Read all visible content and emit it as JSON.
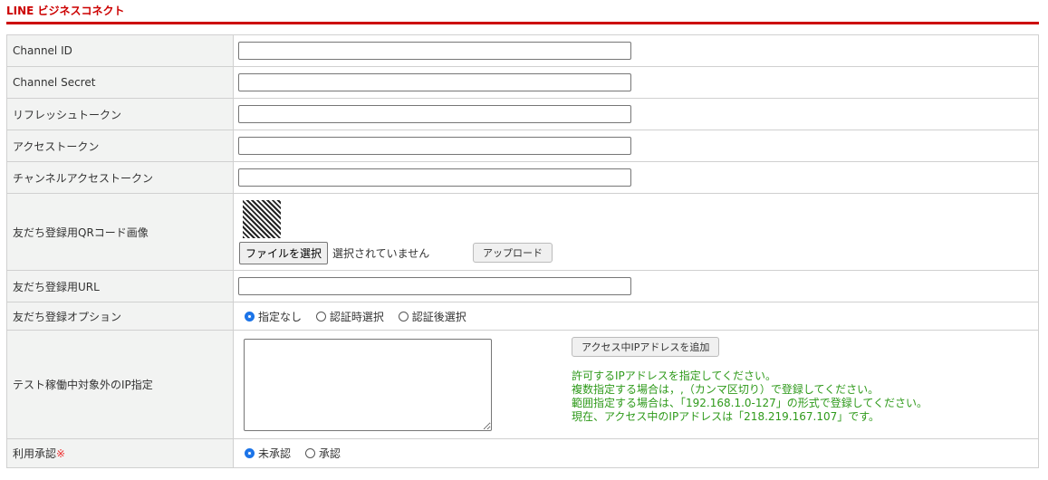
{
  "title": "LINE ビジネスコネクト",
  "rows": {
    "channel_id": "Channel ID",
    "channel_secret": "Channel Secret",
    "refresh_token": "リフレッシュトークン",
    "access_token": "アクセストークン",
    "channel_access_token": "チャンネルアクセストークン",
    "qr_image": "友だち登録用QRコード画像",
    "url": "友だち登録用URL",
    "option": "友だち登録オプション",
    "ip": "テスト稼働中対象外のIP指定",
    "approval": "利用承認",
    "required_mark": "※"
  },
  "qr": {
    "file_button": "ファイルを選択",
    "file_status": "選択されていません",
    "upload_button": "アップロード"
  },
  "option_radios": [
    {
      "label": "指定なし",
      "checked": true
    },
    {
      "label": "認証時選択",
      "checked": false
    },
    {
      "label": "認証後選択",
      "checked": false
    }
  ],
  "ip": {
    "add_button": "アクセス中IPアドレスを追加",
    "notes": [
      "許可するIPアドレスを指定してください。",
      "複数指定する場合は，,（カンマ区切り）で登録してください。",
      "範囲指定する場合は、「192.168.1.0-127」の形式で登録してください。",
      "現在、アクセス中のIPアドレスは「218.219.167.107」です。"
    ]
  },
  "approval_radios": [
    {
      "label": "未承認",
      "checked": true
    },
    {
      "label": "承認",
      "checked": false
    }
  ]
}
